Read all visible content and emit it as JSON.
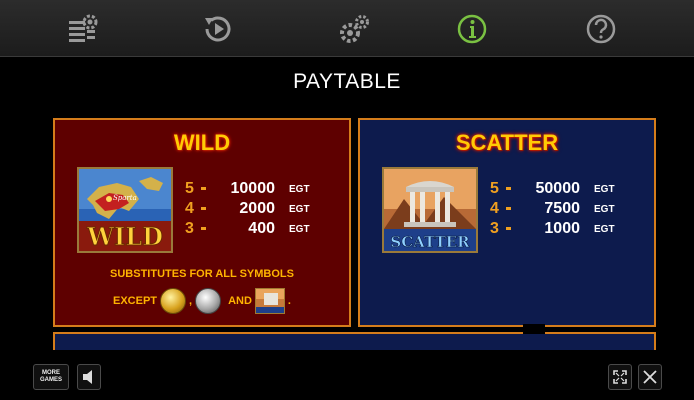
{
  "toolbar": {
    "buttons": [
      {
        "icon": "paylines-settings-icon"
      },
      {
        "icon": "autoplay-icon"
      },
      {
        "icon": "settings-icon"
      },
      {
        "icon": "info-icon",
        "active": true,
        "color": "#7ac142"
      },
      {
        "icon": "help-icon"
      }
    ]
  },
  "page_title": "PAYTABLE",
  "wild": {
    "title": "WILD",
    "symbol_text": "WILD",
    "symbol_map_label": "Sparta",
    "pays": [
      {
        "count": "5",
        "amount": "10000",
        "unit": "EGT"
      },
      {
        "count": "4",
        "amount": "2000",
        "unit": "EGT"
      },
      {
        "count": "3",
        "amount": "400",
        "unit": "EGT"
      }
    ],
    "substitutes_text": "SUBSTITUTES FOR ALL SYMBOLS",
    "except_label": "EXCEPT",
    "comma": ",",
    "and_label": "AND",
    "period": "."
  },
  "scatter": {
    "title": "SCATTER",
    "symbol_text": "SCATTER",
    "pays": [
      {
        "count": "5",
        "amount": "50000",
        "unit": "EGT"
      },
      {
        "count": "4",
        "amount": "7500",
        "unit": "EGT"
      },
      {
        "count": "3",
        "amount": "1000",
        "unit": "EGT"
      }
    ]
  },
  "bottom": {
    "more_games_line1": "MORE",
    "more_games_line2": "GAMES",
    "sound_icon": "speaker-icon",
    "fullscreen_icon": "fullscreen-icon",
    "close_icon": "close-icon"
  },
  "colors": {
    "accent_title": "#ffcb05",
    "panel_border": "#d57d1b",
    "wild_bg": "#5e0000",
    "scatter_bg": "#0d1b4d",
    "count_color": "#f0a020"
  }
}
